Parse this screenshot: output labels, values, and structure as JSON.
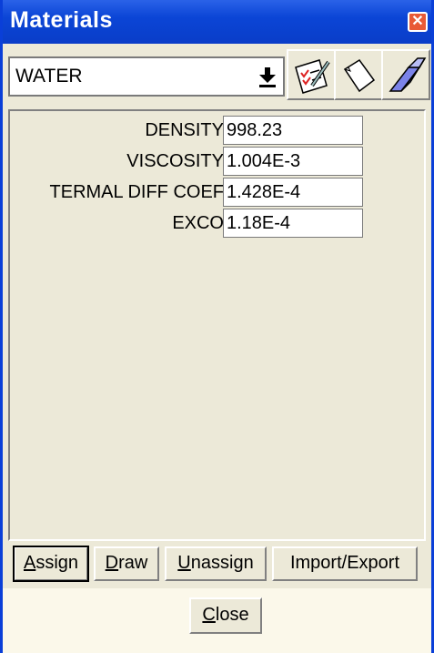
{
  "window": {
    "title": "Materials",
    "close_glyph": "✕"
  },
  "material_select": {
    "value": "WATER",
    "icon": "dropdown-arrow-icon"
  },
  "toolbar": {
    "buttons": [
      {
        "name": "edit-material",
        "icon": "checklist-pencil-icon"
      },
      {
        "name": "new-material",
        "icon": "blank-page-icon"
      },
      {
        "name": "erase-material",
        "icon": "eraser-icon"
      }
    ]
  },
  "properties": [
    {
      "label": "DENSITY",
      "value": "998.23"
    },
    {
      "label": "VISCOSITY",
      "value": "1.004E-3"
    },
    {
      "label": "TERMAL DIFF COEF",
      "value": "1.428E-4"
    },
    {
      "label": "EXCO",
      "value": "1.18E-4"
    }
  ],
  "actions": {
    "assign": {
      "first": "A",
      "rest": "ssign"
    },
    "draw": {
      "first": "D",
      "rest": "raw"
    },
    "unassign": {
      "first": "U",
      "rest": "nassign"
    },
    "import_export": "Import/Export"
  },
  "close_button": {
    "first": "C",
    "rest": "lose"
  },
  "colors": {
    "titlebar": "#0b45d6",
    "panel": "#ece9d8",
    "close_icon": "#e85a37"
  }
}
